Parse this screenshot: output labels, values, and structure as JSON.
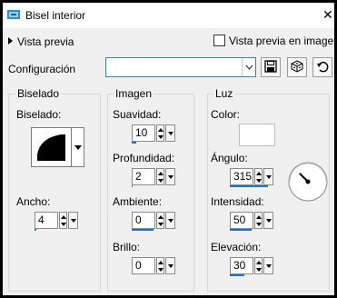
{
  "window": {
    "title": "Bisel interior",
    "close_icon": "close-icon"
  },
  "preview": {
    "toggle_label": "Vista previa",
    "checkbox_label": "Vista previa en imagen",
    "checked": false
  },
  "config": {
    "label": "Configuración",
    "value": ""
  },
  "groups": {
    "bevel": {
      "title": "Biselado",
      "shape_label": "Biselado:",
      "width_label": "Ancho:",
      "width_value": "4",
      "width_level": 0.04
    },
    "image": {
      "title": "Imagen",
      "smoothness_label": "Suavidad:",
      "smoothness_value": "10",
      "smoothness_level": 0.1,
      "depth_label": "Profundidad:",
      "depth_value": "2",
      "depth_level": 0.02,
      "ambience_label": "Ambiente:",
      "ambience_value": "0",
      "ambience_level": 0.5,
      "brightness_label": "Brillo:",
      "brightness_value": "0",
      "brightness_level": 0.0
    },
    "light": {
      "title": "Luz",
      "color_label": "Color:",
      "color_value": "#ffffff",
      "angle_label": "Ángulo:",
      "angle_value": "315",
      "angle_level": 0.875,
      "intensity_label": "Intensidad:",
      "intensity_value": "50",
      "intensity_level": 0.5,
      "elevation_label": "Elevación:",
      "elevation_value": "30",
      "elevation_level": 0.33
    }
  },
  "colors": {
    "accent": "#1874cd",
    "window_bg": "#f0f0f0"
  }
}
